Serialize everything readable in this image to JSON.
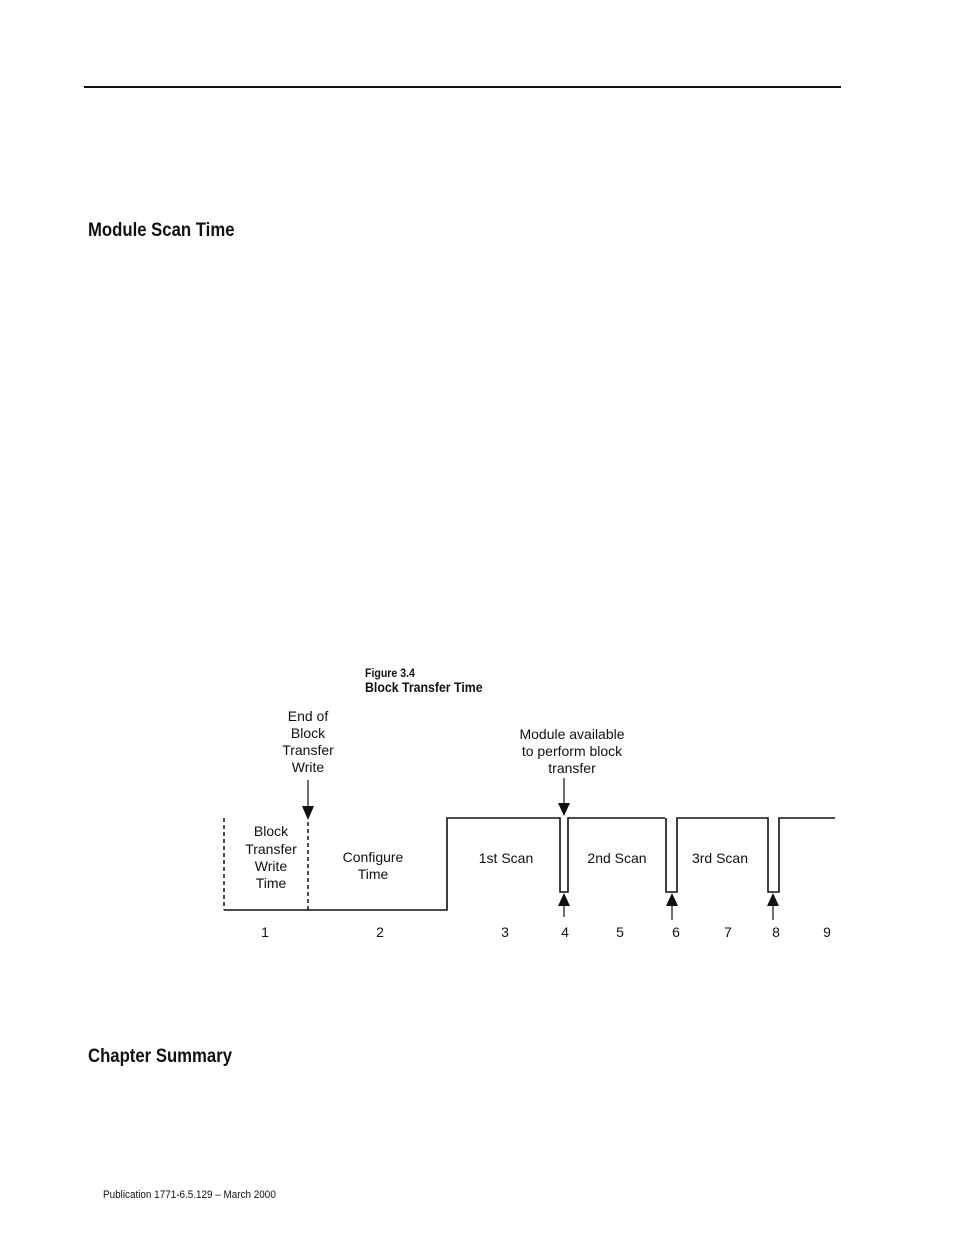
{
  "headings": {
    "section1": "Module Scan Time",
    "section2": "Chapter Summary"
  },
  "figure": {
    "number": "Figure 3.4",
    "title": "Block Transfer Time",
    "annotations": {
      "end_of_bt_write": [
        "End of",
        "Block",
        "Transfer",
        "Write"
      ],
      "module_available": [
        "Module available",
        "to perform block",
        "transfer"
      ]
    },
    "regions": {
      "bt_write_time": [
        "Block",
        "Transfer",
        "Write",
        "Time"
      ],
      "configure_time": [
        "Configure",
        "Time"
      ],
      "scan1": "1st Scan",
      "scan2": "2nd Scan",
      "scan3": "3rd Scan"
    },
    "markers": [
      "1",
      "2",
      "3",
      "4",
      "5",
      "6",
      "7",
      "8",
      "9"
    ]
  },
  "footer": {
    "publication": "Publication 1771-6.5.129 – March 2000"
  }
}
